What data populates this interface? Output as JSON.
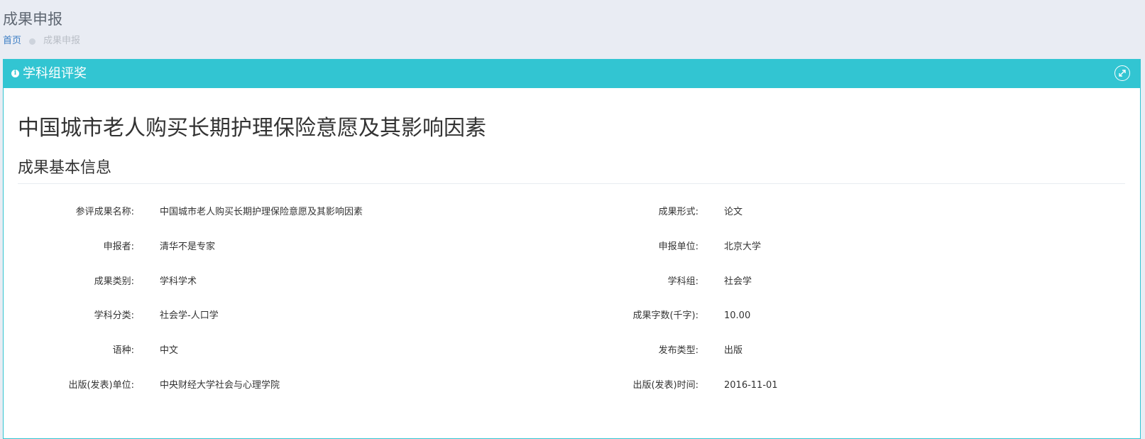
{
  "header": {
    "title": "成果申报",
    "breadcrumb": {
      "home": "首页",
      "current": "成果申报"
    }
  },
  "portlet": {
    "caption": "学科组评奖",
    "caption_icon": "info-icon",
    "expand_icon": "expand-icon",
    "accent_color": "#32c5d2"
  },
  "document": {
    "title": "中国城市老人购买长期护理保险意愿及其影响因素",
    "section_heading": "成果基本信息"
  },
  "fields": [
    {
      "left_label": "参评成果名称:",
      "left_value": "中国城市老人购买长期护理保险意愿及其影响因素",
      "right_label": "成果形式:",
      "right_value": "论文"
    },
    {
      "left_label": "申报者:",
      "left_value": "清华不是专家",
      "right_label": "申报单位:",
      "right_value": "北京大学"
    },
    {
      "left_label": "成果类别:",
      "left_value": "学科学术",
      "right_label": "学科组:",
      "right_value": "社会学"
    },
    {
      "left_label": "学科分类:",
      "left_value": "社会学-人口学",
      "right_label": "成果字数(千字):",
      "right_value": "10.00"
    },
    {
      "left_label": "语种:",
      "left_value": "中文",
      "right_label": "发布类型:",
      "right_value": "出版"
    },
    {
      "left_label": "出版(发表)单位:",
      "left_value": "中央财经大学社会与心理学院",
      "right_label": "出版(发表)时间:",
      "right_value": "2016-11-01"
    }
  ]
}
